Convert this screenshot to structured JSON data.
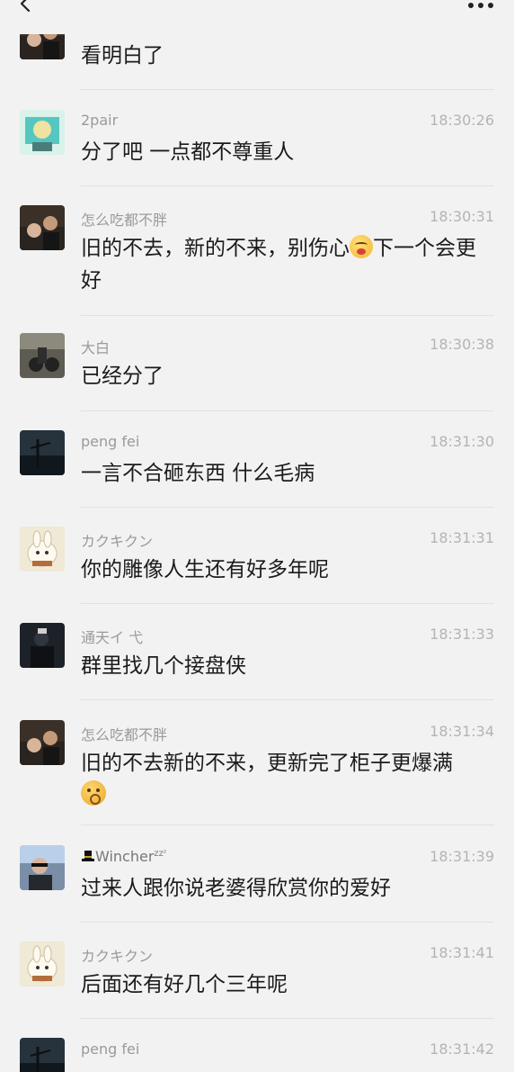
{
  "header": {
    "back_icon": "chevron-left-icon",
    "more_icon": "more-horizontal-icon"
  },
  "messages": [
    {
      "name": "",
      "time": "",
      "text": "看明白了",
      "avatar": "avatar-man-couple"
    },
    {
      "name": "2pair",
      "time": "18:30:26",
      "text": "分了吧 一点都不尊重人",
      "avatar": "avatar-cartoon-cyan"
    },
    {
      "name": "怎么吃都不胖",
      "time": "18:30:31",
      "text_before": "旧的不去，新的不来，别伤心",
      "text_after": "下一个会更好",
      "emoji": "worried-face-icon",
      "avatar": "avatar-man-couple"
    },
    {
      "name": "大白",
      "time": "18:30:38",
      "text": "已经分了",
      "avatar": "avatar-motorbike"
    },
    {
      "name": "peng fei",
      "time": "18:31:30",
      "text": "一言不合砸东西 什么毛病",
      "avatar": "avatar-dark-sky"
    },
    {
      "name": "カクキクン",
      "time": "18:31:31",
      "text": "你的雕像人生还有好多年呢",
      "avatar": "avatar-rabbit"
    },
    {
      "name": "通天イ 弋",
      "time": "18:31:33",
      "text": "群里找几个接盘侠",
      "avatar": "avatar-dark-person"
    },
    {
      "name": "怎么吃都不胖",
      "time": "18:31:34",
      "text": "旧的不去新的不来，更新完了柜子更爆满",
      "emoji": "shush-face-icon",
      "avatar": "avatar-man-couple"
    },
    {
      "name": "Wincher",
      "name_suffix": "zzᶻ",
      "time": "18:31:39",
      "text": "过来人跟你说老婆得欣赏你的爱好",
      "avatar": "avatar-man-sunglasses"
    },
    {
      "name": "カクキクン",
      "time": "18:31:41",
      "text": "后面还有好几个三年呢",
      "avatar": "avatar-rabbit"
    },
    {
      "name": "peng fei",
      "time": "18:31:42",
      "text": "",
      "avatar": "avatar-dark-sky"
    }
  ]
}
